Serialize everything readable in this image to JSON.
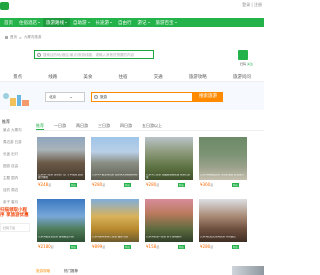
{
  "header": {
    "top_links": "登录 | 注册"
  },
  "nav": {
    "items": [
      {
        "label": "首页",
        "active": false,
        "caret": false
      },
      {
        "label": "住宿酒店",
        "active": false,
        "caret": true
      },
      {
        "label": "旅游路线",
        "active": true,
        "caret": true
      },
      {
        "label": "自助游",
        "active": false,
        "caret": true
      },
      {
        "label": "长途游",
        "active": false,
        "caret": true
      },
      {
        "label": "自由行",
        "active": false,
        "caret": false
      },
      {
        "label": "游记",
        "active": false,
        "caret": true
      },
      {
        "label": "旅游百宝",
        "active": false,
        "caret": true
      }
    ]
  },
  "breadcrumb": {
    "home": "首页",
    "sep": ">",
    "current": "九寨沟旅游"
  },
  "top_search": {
    "placeholder": "搜索目的地/酒店/景点/旅游线路，或输入其他您想要的内容"
  },
  "qr": {
    "label": "扫码",
    "sub": "关注"
  },
  "categories": [
    "景点",
    "线路",
    "美食",
    "住宿",
    "交通",
    "旅游攻略",
    "旅游问问"
  ],
  "banner": {
    "origin_label": "北京",
    "destination_value": "旅游",
    "search_button": "搜索旅游"
  },
  "sidebar": {
    "heading": "推荐",
    "rows": [
      "景点 九寨沟",
      "周边游 日游",
      "长途 出行",
      "团游 自由",
      "主题 国内",
      "目的 周边",
      "亲子 蜜月"
    ],
    "promo": "扫描领取小程序 享旅游优惠",
    "app_label": "扫码下载"
  },
  "tabs": [
    {
      "label": "推荐",
      "active": true
    },
    {
      "label": "一日游",
      "active": false
    },
    {
      "label": "两日游",
      "active": false
    },
    {
      "label": "三日游",
      "active": false
    },
    {
      "label": "四日游",
      "active": false
    },
    {
      "label": "五日游以上",
      "active": false
    }
  ],
  "cards": [
    {
      "caption": "九寨沟一日游 含景区门票 专车接送 超值旅行体验",
      "price": "¥248",
      "unit": "起",
      "tag": "特价"
    },
    {
      "caption": "九寨沟+黄龙两日游 高原风光纯玩无购物",
      "price": "¥280",
      "unit": "起",
      "tag": "特价"
    },
    {
      "caption": "九寨沟三日游 含藏族歌舞表演 观景台游览",
      "price": "¥280",
      "unit": "起",
      "tag": "特价"
    },
    {
      "caption": "九寨沟纯玩四日游 住景区酒店 舒适出行",
      "price": "¥360",
      "unit": "起",
      "tag": "特价"
    },
    {
      "caption": "九寨沟黄龙五日游 高端精品小团",
      "price": "¥2180",
      "unit": "起",
      "tag": "特价"
    },
    {
      "caption": "九寨沟秋季彩林三日游 摄影专线",
      "price": "¥899",
      "unit": "起",
      "tag": "特价"
    },
    {
      "caption": "九寨沟花海一日游 亲子游玩推荐",
      "price": "¥158",
      "unit": "起",
      "tag": "特价"
    },
    {
      "caption": "九寨沟民俗文化两日游 特色餐饮",
      "price": "¥280",
      "unit": "起",
      "tag": "特价"
    }
  ],
  "bottom": {
    "logo": "旅游攻略",
    "text": "热门推荐"
  }
}
